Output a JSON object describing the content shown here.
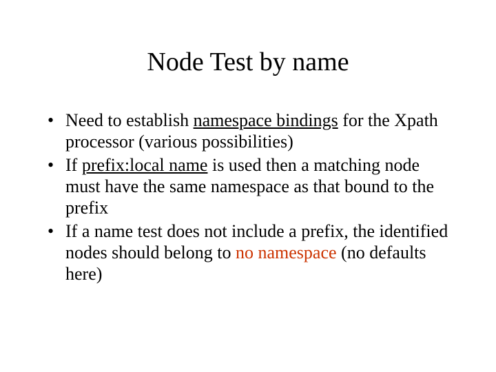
{
  "title": "Node Test by name",
  "bullets": {
    "b1a": "Need to establish ",
    "b1u": "namespace bindings",
    "b1b": " for the Xpath processor (various possibilities)",
    "b2a": "If ",
    "b2u": "prefix:local name",
    "b2b": " is used then a matching node must have the same namespace as that bound to the prefix",
    "b3a": "If a name test does not include a prefix, the identified nodes should belong to ",
    "b3r": "no namespace",
    "b3b": " (no defaults here)"
  }
}
